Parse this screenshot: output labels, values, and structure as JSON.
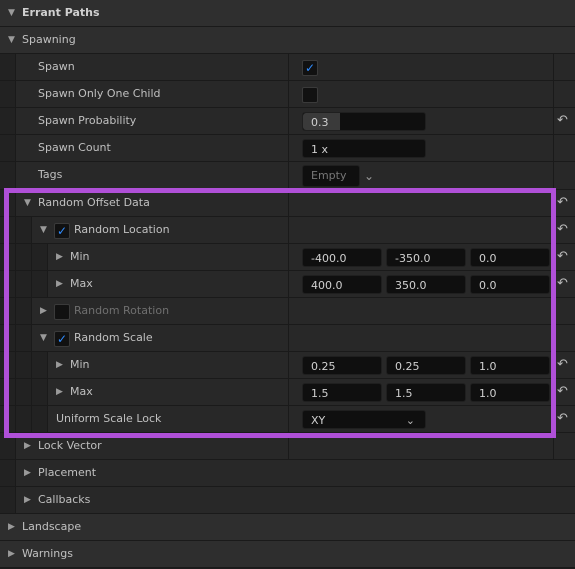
{
  "colors": {
    "highlight": "#b050d8",
    "checkmark": "#2f8cff"
  },
  "rows": [
    {
      "label": "Errant Paths",
      "level": 0,
      "arrow": "down",
      "bold": true,
      "type": "top"
    },
    {
      "label": "Spawning",
      "level": 0,
      "arrow": "down",
      "type": "cat"
    },
    {
      "label": "Spawn",
      "level": 1,
      "value": {
        "kind": "checkbox",
        "checked": true
      }
    },
    {
      "label": "Spawn Only One Child",
      "level": 1,
      "value": {
        "kind": "checkbox",
        "checked": false
      }
    },
    {
      "label": "Spawn Probability",
      "level": 1,
      "value": {
        "kind": "slider",
        "text": "0.3",
        "fraction": 0.3
      },
      "reset": true
    },
    {
      "label": "Spawn Count",
      "level": 1,
      "value": {
        "kind": "text",
        "text": "1 x"
      }
    },
    {
      "label": "Tags",
      "level": 1,
      "value": {
        "kind": "tags",
        "text": "Empty"
      }
    },
    {
      "label": "Random Offset Data",
      "level": 1,
      "arrow": "down",
      "reset": true,
      "group": true
    },
    {
      "label": "Random Location",
      "level": 2,
      "arrow": "down",
      "checkbox": true,
      "checked": true,
      "reset": true
    },
    {
      "label": "Min",
      "level": 3,
      "arrow": "right",
      "value": {
        "kind": "vector",
        "values": [
          "-400.0",
          "-350.0",
          "0.0"
        ]
      },
      "reset": true
    },
    {
      "label": "Max",
      "level": 3,
      "arrow": "right",
      "value": {
        "kind": "vector",
        "values": [
          "400.0",
          "350.0",
          "0.0"
        ]
      },
      "reset": true
    },
    {
      "label": "Random Rotation",
      "level": 2,
      "arrow": "right",
      "checkbox": true,
      "checked": false,
      "disabled": true
    },
    {
      "label": "Random Scale",
      "level": 2,
      "arrow": "down",
      "checkbox": true,
      "checked": true
    },
    {
      "label": "Min",
      "level": 3,
      "arrow": "right",
      "value": {
        "kind": "vector",
        "values": [
          "0.25",
          "0.25",
          "1.0"
        ]
      },
      "reset": true
    },
    {
      "label": "Max",
      "level": 3,
      "arrow": "right",
      "value": {
        "kind": "vector",
        "values": [
          "1.5",
          "1.5",
          "1.0"
        ]
      },
      "reset": true
    },
    {
      "label": "Uniform Scale Lock",
      "level": 3,
      "value": {
        "kind": "dropdown",
        "text": "XY"
      },
      "reset": true
    },
    {
      "label": "Lock Vector",
      "level": 1,
      "arrow": "right",
      "group": true
    },
    {
      "label": "Placement",
      "level": 1,
      "arrow": "right",
      "nosplit": true
    },
    {
      "label": "Callbacks",
      "level": 1,
      "arrow": "right",
      "nosplit": true
    },
    {
      "label": "Landscape",
      "level": 0,
      "arrow": "right",
      "type": "cat"
    },
    {
      "label": "Warnings",
      "level": 0,
      "arrow": "right",
      "type": "cat"
    }
  ]
}
